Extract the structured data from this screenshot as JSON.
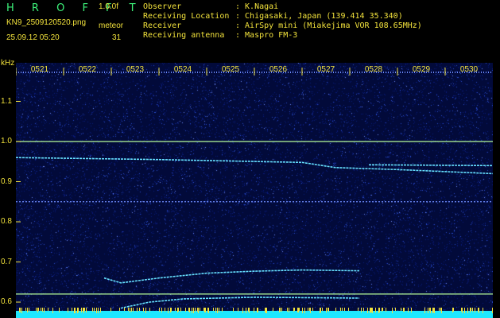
{
  "header": {
    "app_title": "H R O F F T",
    "version": "1.0.0f",
    "filename": "KN9_2509120520.png",
    "datetime": "25.09.12 05:20",
    "meteor_label": "meteor",
    "meteor_count": "31"
  },
  "info": [
    {
      "label": "Observer",
      "value": ": K.Nagai"
    },
    {
      "label": "Receiving Location",
      "value": ": Chigasaki, Japan (139.414 35.340)"
    },
    {
      "label": "Receiver",
      "value": ": AirSpy mini (Miakejima VOR 108.65MHz)"
    },
    {
      "label": "Receiving antenna",
      "value": ": Maspro FM-3"
    }
  ],
  "colors": {
    "background": "#000000",
    "noise_dark": "#0a1a7a",
    "noise_light": "#2a4fd0",
    "trace": "#66e0ff",
    "line_green": "#b8ff9a",
    "text": "#f2e23c",
    "bottom_band": "#1ee8ff"
  },
  "chart_data": {
    "type": "heatmap",
    "ylabel": "kHz",
    "ylim": [
      0.58,
      1.18
    ],
    "yticks": [
      "1.1",
      "1.0",
      "0.9",
      "0.8",
      "0.7",
      "0.6"
    ],
    "xticks": [
      "0521",
      "0522",
      "0523",
      "0524",
      "0525",
      "0526",
      "0527",
      "0528",
      "0529",
      "0530"
    ],
    "xlim": [
      0,
      10
    ],
    "horizontal_lines": [
      1.0,
      0.85,
      0.62
    ],
    "traces": [
      {
        "points": [
          [
            0,
            0.96
          ],
          [
            3,
            0.955
          ],
          [
            6,
            0.948
          ],
          [
            6.7,
            0.935
          ],
          [
            8,
            0.93
          ],
          [
            10,
            0.92
          ]
        ]
      },
      {
        "points": [
          [
            7.4,
            0.942
          ],
          [
            10,
            0.94
          ]
        ]
      },
      {
        "points": [
          [
            1.85,
            0.66
          ],
          [
            2.2,
            0.648
          ],
          [
            3,
            0.66
          ],
          [
            4,
            0.672
          ],
          [
            5,
            0.677
          ],
          [
            6,
            0.68
          ],
          [
            7.2,
            0.678
          ]
        ]
      },
      {
        "points": [
          [
            2.2,
            0.585
          ],
          [
            2.8,
            0.6
          ],
          [
            3.5,
            0.608
          ],
          [
            5,
            0.612
          ],
          [
            7.2,
            0.61
          ]
        ]
      }
    ]
  }
}
